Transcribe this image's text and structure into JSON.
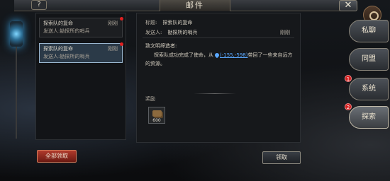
{
  "window": {
    "title": "邮件",
    "help_label": "?",
    "close_label": "✕"
  },
  "mail_list": [
    {
      "subject": "探索队的复命",
      "tag": "刚刚",
      "sender": "发送人:勘探所的哨兵",
      "selected": false,
      "unread": true
    },
    {
      "subject": "探索队的复命",
      "tag": "刚刚",
      "sender": "发送人:勘探所的哨兵",
      "selected": true,
      "unread": true
    }
  ],
  "detail": {
    "title_label": "标题:",
    "title_value": "探索队的复命",
    "sender_label": "发送人:",
    "sender_value": "勘探所的哨兵",
    "time": "刚刚",
    "greeting": "致文明缔造者:",
    "body_before": "探索队成功完成了使命，从",
    "coords": "(-155,-598)",
    "body_after": "带回了一些来自远方的资源。",
    "reward_label": "奖励",
    "reward_qty": "600"
  },
  "buttons": {
    "collect_all": "全部领取",
    "collect": "领取"
  },
  "tabs": [
    {
      "label": "私聊",
      "badge": ""
    },
    {
      "label": "同盟",
      "badge": ""
    },
    {
      "label": "系统",
      "badge": "1"
    },
    {
      "label": "探索",
      "badge": "2"
    }
  ]
}
